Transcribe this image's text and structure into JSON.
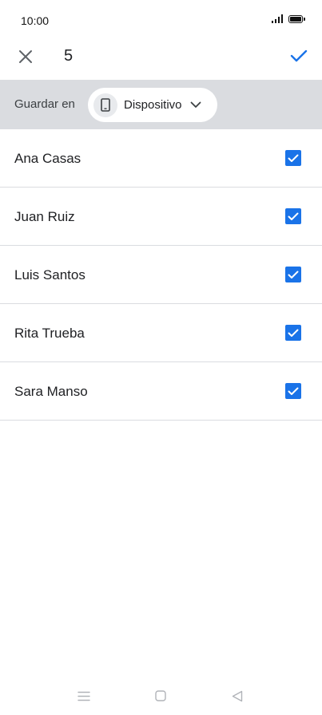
{
  "status_bar": {
    "time": "10:00",
    "icons": [
      "signal-icon",
      "battery-icon"
    ]
  },
  "toolbar": {
    "close_icon": "close-icon",
    "selected_count": "5",
    "confirm_icon": "check-icon",
    "accent_color": "#1a73e8"
  },
  "save_location": {
    "label": "Guardar en",
    "selected": "Dispositivo",
    "icon": "phone-icon",
    "dropdown_icon": "chevron-down-icon"
  },
  "contacts": [
    {
      "name": "Ana Casas",
      "checked": true
    },
    {
      "name": "Juan Ruiz",
      "checked": true
    },
    {
      "name": "Luis Santos",
      "checked": true
    },
    {
      "name": "Rita Trueba",
      "checked": true
    },
    {
      "name": "Sara Manso",
      "checked": true
    }
  ],
  "nav_bar": {
    "icons": [
      "menu-icon",
      "home-icon",
      "back-icon"
    ]
  }
}
